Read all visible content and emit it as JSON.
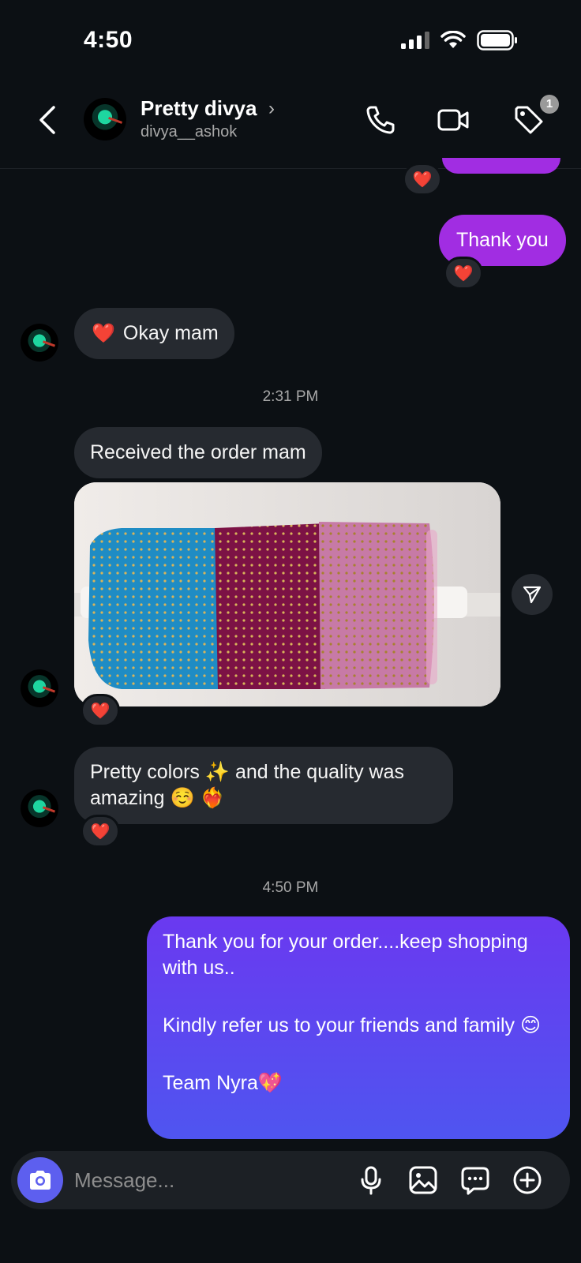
{
  "status_bar": {
    "time": "4:50"
  },
  "header": {
    "contact_name": "Pretty divya",
    "contact_handle": "divya__ashok",
    "badge_count": "1"
  },
  "messages": {
    "sent_thanks": "Thank you",
    "reply_okay": "Okay mam",
    "timestamp_1": "2:31 PM",
    "received_order": "Received the order mam",
    "compliment": "Pretty colors ✨ and the quality was amazing ☺️ ❤️‍🔥",
    "timestamp_2": "4:50 PM",
    "final_line1": "Thank you for your order....keep shopping with us..",
    "final_line2": "Kindly refer us to your friends and family 😊",
    "final_line3": "Team Nyra💖",
    "reaction_emoji": "❤️"
  },
  "composer": {
    "placeholder": "Message..."
  },
  "colors": {
    "background": "#0c1014",
    "incoming_bubble": "#262a30",
    "outgoing_purple": "#a12de2",
    "outgoing_gradient_top": "#6a39f0",
    "outgoing_gradient_bottom": "#4f55f0",
    "camera_button": "#5d5fef"
  },
  "icons": [
    "back-icon",
    "phone-icon",
    "video-icon",
    "tag-icon",
    "share-icon",
    "camera-icon",
    "microphone-icon",
    "gallery-icon",
    "sticker-icon",
    "plus-icon"
  ]
}
